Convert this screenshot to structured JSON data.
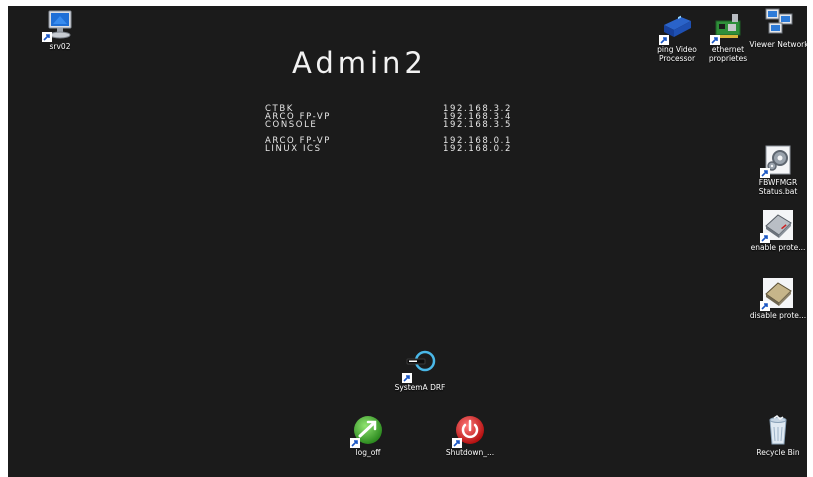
{
  "wallpaper": {
    "title": "Admin2",
    "ip_list": [
      {
        "name": "CTBK",
        "ip": "192.168.3.2"
      },
      {
        "name": "ARCO FP-VP",
        "ip": "192.168.3.4"
      },
      {
        "name": "CONSOLE",
        "ip": "192.168.3.5"
      },
      {
        "name": "ARCO FP-VP",
        "ip": "192.168.0.1"
      },
      {
        "name": "LINUX ICS",
        "ip": "192.168.0.2"
      }
    ]
  },
  "desktop_icons": {
    "srv02": {
      "label": "srv02",
      "icon": "computer-icon"
    },
    "ping_video": {
      "label": "ping Video Processor",
      "icon": "video-processor-icon"
    },
    "ethernet": {
      "label": "ethernet proprietes",
      "icon": "network-card-icon"
    },
    "viewer_network": {
      "label": "Viewer Network",
      "icon": "network-viewer-icon"
    },
    "fbwfmgr": {
      "label": "FBWFMGR Status.bat",
      "icon": "batch-file-icon"
    },
    "enable_prote": {
      "label": "enable prote...",
      "icon": "drive-icon"
    },
    "disable_prote": {
      "label": "disable prote...",
      "icon": "drive-icon"
    },
    "systema_drf": {
      "label": "SystemA DRF",
      "icon": "device-icon"
    },
    "log_off": {
      "label": "log_off",
      "icon": "log-off-icon"
    },
    "shutdown": {
      "label": "Shutdown_...",
      "icon": "power-icon"
    },
    "recycle_bin": {
      "label": "Recycle Bin",
      "icon": "recycle-bin-icon"
    }
  },
  "colors": {
    "desktop_background": "#1b1b1b",
    "icon_label": "#ffffff",
    "log_off_green": "#3aa52a",
    "shutdown_red": "#d61f1f"
  }
}
